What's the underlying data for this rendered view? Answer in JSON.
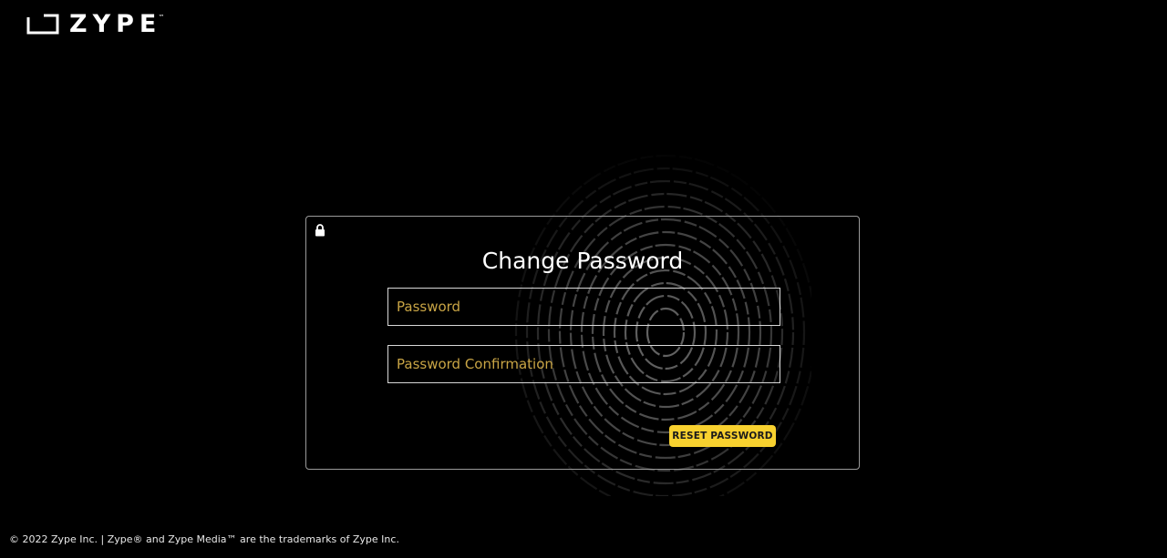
{
  "brand": {
    "name": "ZYPE",
    "trademark": "™"
  },
  "form": {
    "title": "Change Password",
    "password_placeholder": "Password",
    "confirmation_placeholder": "Password Confirmation",
    "submit_label": "RESET PASSWORD"
  },
  "footer": {
    "text": "© 2022 Zype Inc. | Zype® and Zype Media™ are the trademarks of Zype Inc."
  },
  "icons": {
    "logo": "zype-logo-icon",
    "lock": "lock-icon",
    "background": "fingerprint-icon"
  },
  "colors": {
    "background": "#000000",
    "accent": "#f8d12f",
    "placeholder": "#c9a545",
    "card_border": "#9a9a9a",
    "text": "#ffffff"
  }
}
